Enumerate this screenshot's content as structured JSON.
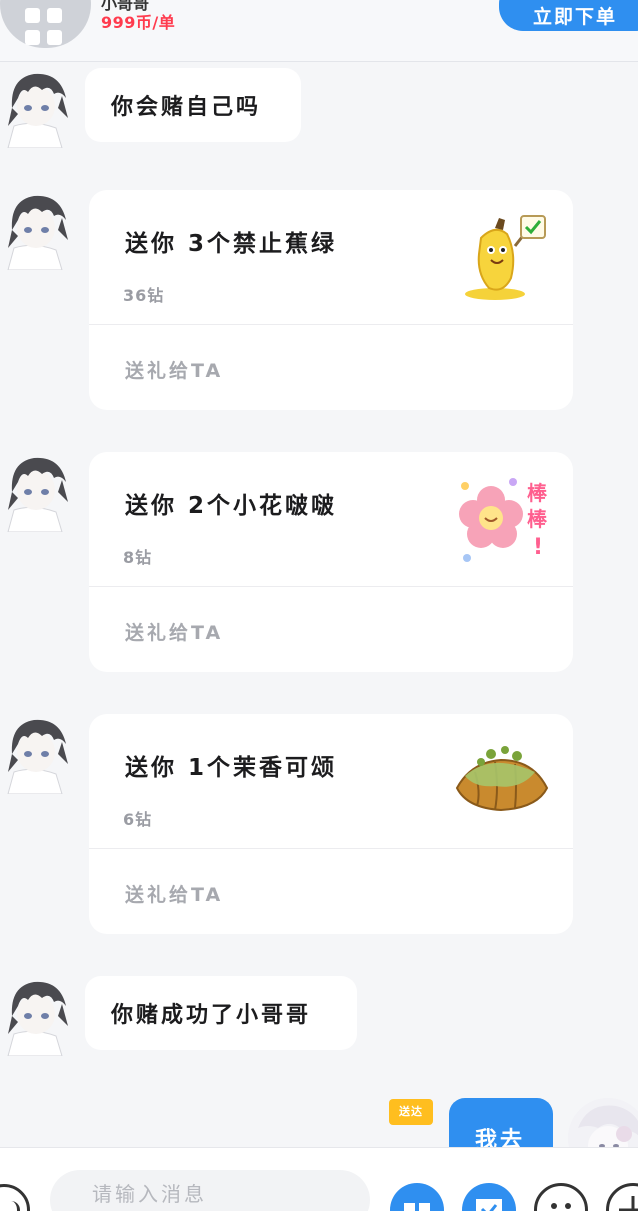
{
  "order_bar": {
    "title": "小哥哥",
    "price": "999币/单",
    "order_button": "立即下单"
  },
  "messages": [
    {
      "type": "text",
      "text": "你会赌自己吗"
    },
    {
      "type": "gift",
      "title": "送你 3个禁止蕉绿",
      "price": "36钻",
      "send_label": "送礼给TA",
      "image": "banana-sticker"
    },
    {
      "type": "gift",
      "title": "送你 2个小花啵啵",
      "price": "8钻",
      "send_label": "送礼给TA",
      "image": "flower-sticker"
    },
    {
      "type": "gift",
      "title": "送你 1个茉香可颂",
      "price": "6钻",
      "send_label": "送礼给TA",
      "image": "croissant-sticker"
    },
    {
      "type": "text",
      "text": "你赌成功了小哥哥"
    }
  ],
  "outgoing": {
    "status_badge": "送达",
    "text": "我去"
  },
  "input_bar": {
    "placeholder": "请输入消息",
    "icons": [
      "voice-icon",
      "gift-icon",
      "order-icon",
      "emoji-icon",
      "plus-icon"
    ]
  },
  "colors": {
    "accent": "#2f8ff0",
    "price_red": "#ff3b4e",
    "badge_yellow": "#ffbe1f",
    "background": "#f5f6f8"
  }
}
